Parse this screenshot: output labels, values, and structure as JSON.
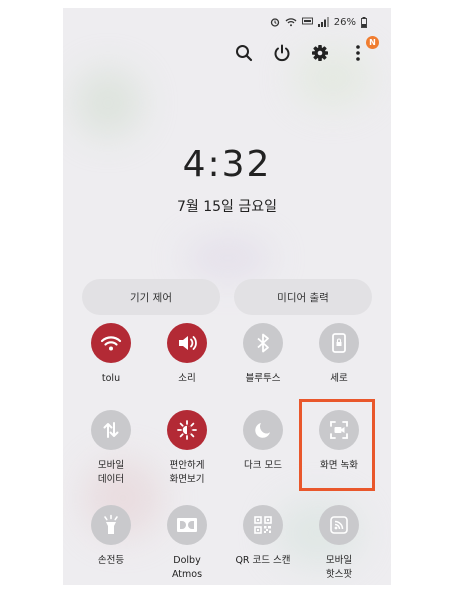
{
  "status": {
    "battery": "26%"
  },
  "lockscreen": {
    "time": "4:32",
    "date": "7월 15일 금요일"
  },
  "top_icons": {
    "badge": "N"
  },
  "pills": {
    "device_control": "기기 제어",
    "media_output": "미디어 출력"
  },
  "tiles": [
    {
      "label": "tolu"
    },
    {
      "label": "소리"
    },
    {
      "label": "블루투스"
    },
    {
      "label": "세로"
    },
    {
      "label": "모바일\n데이터"
    },
    {
      "label": "편안하게\n화면보기"
    },
    {
      "label": "다크 모드"
    },
    {
      "label": "화면 녹화"
    },
    {
      "label": "손전등"
    },
    {
      "label": "Dolby\nAtmos"
    },
    {
      "label": "QR 코드 스캔"
    },
    {
      "label": "모바일\n핫스팟"
    }
  ],
  "colors": {
    "active_tile": "#b32a35",
    "inactive_tile": "#c9c9cc",
    "highlight": "#e9572b"
  }
}
